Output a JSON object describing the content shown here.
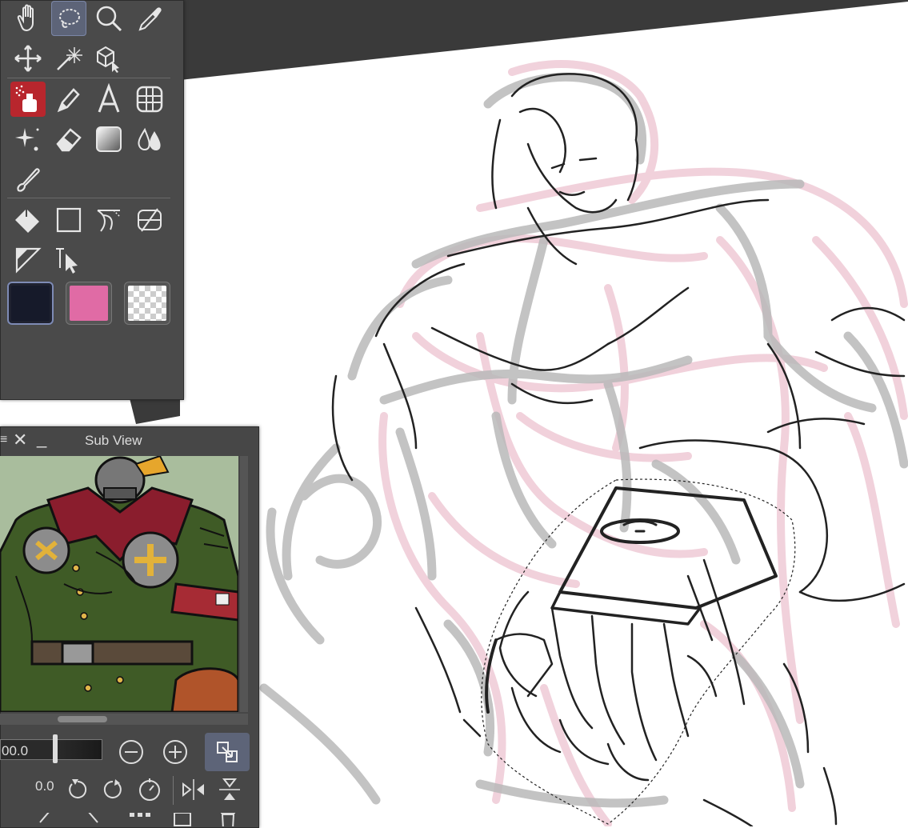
{
  "canvas": {
    "paper_color": "#ffffff",
    "workspace_color": "#3a3a3a",
    "rough_color": "#f0cdd8",
    "sketch_color": "#b9b9b9",
    "line_color": "#222222"
  },
  "tool_panel": {
    "tools": [
      {
        "name": "hand-icon",
        "active": false
      },
      {
        "name": "lasso-selection-icon",
        "active": true
      },
      {
        "name": "zoom-icon",
        "active": false
      },
      {
        "name": "eyedropper-icon",
        "active": false
      },
      {
        "name": "move-icon",
        "active": false
      },
      {
        "name": "auto-select-wand-icon",
        "active": false
      },
      {
        "name": "3d-object-operation-icon",
        "active": false
      },
      {
        "name": "airbrush-icon",
        "active": true
      },
      {
        "name": "pen-icon",
        "active": false
      },
      {
        "name": "text-icon",
        "active": false
      },
      {
        "name": "frame-border-icon",
        "active": false
      },
      {
        "name": "decoration-sparkle-icon",
        "active": false
      },
      {
        "name": "eraser-icon",
        "active": false
      },
      {
        "name": "gradient-icon",
        "active": false
      },
      {
        "name": "blend-drops-icon",
        "active": false
      },
      {
        "name": "pencil-brush-icon",
        "active": false
      },
      {
        "name": "fill-bucket-icon",
        "active": false
      },
      {
        "name": "rectangle-figure-icon",
        "active": false
      },
      {
        "name": "ruler-curve-icon",
        "active": false
      },
      {
        "name": "layer-clip-icon",
        "active": false
      },
      {
        "name": "triangle-ruler-icon",
        "active": false
      },
      {
        "name": "object-select-icon",
        "active": false
      }
    ],
    "colors": {
      "main": "#161a2a",
      "sub": "#e06ba5",
      "transparent": "transparent"
    }
  },
  "sub_view": {
    "title": "Sub View",
    "zoom_value": "00.0",
    "rotate_value": "0.0",
    "artwork_bg": "#a9bd9d",
    "uniform_color": "#3f5b26",
    "collar_color": "#8a1d2d",
    "armband_color": "#a62b34"
  }
}
